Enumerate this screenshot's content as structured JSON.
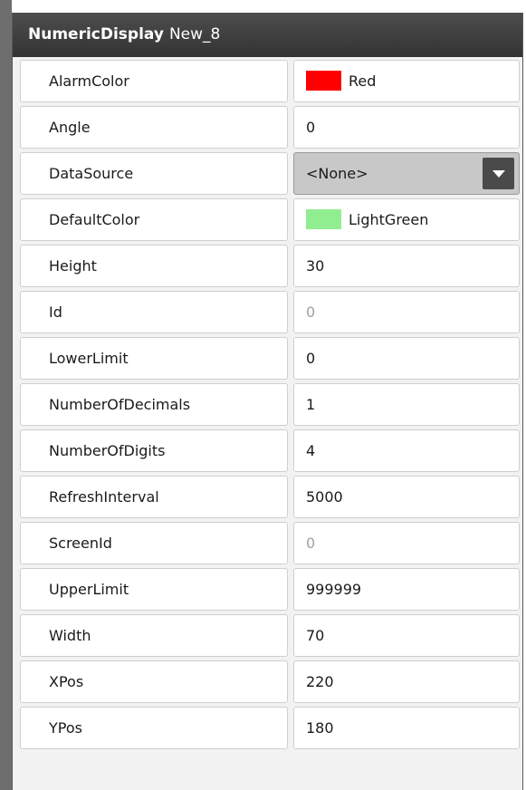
{
  "panel": {
    "type_label": "NumericDisplay",
    "name_label": "New_8"
  },
  "properties": [
    {
      "name": "AlarmColor",
      "value": "Red",
      "swatch": "#ff0000"
    },
    {
      "name": "Angle",
      "value": "0"
    },
    {
      "name": "DataSource",
      "value": "<None>",
      "dropdown": true
    },
    {
      "name": "DefaultColor",
      "value": "LightGreen",
      "swatch": "#90ee90"
    },
    {
      "name": "Height",
      "value": "30"
    },
    {
      "name": "Id",
      "value": "0",
      "readonly": true
    },
    {
      "name": "LowerLimit",
      "value": "0"
    },
    {
      "name": "NumberOfDecimals",
      "value": "1"
    },
    {
      "name": "NumberOfDigits",
      "value": "4"
    },
    {
      "name": "RefreshInterval",
      "value": "5000"
    },
    {
      "name": "ScreenId",
      "value": "0",
      "readonly": true
    },
    {
      "name": "UpperLimit",
      "value": "999999"
    },
    {
      "name": "Width",
      "value": "70"
    },
    {
      "name": "XPos",
      "value": "220"
    },
    {
      "name": "YPos",
      "value": "180"
    }
  ],
  "icons": {
    "dropdown_arrow": "chevron-down-icon"
  }
}
